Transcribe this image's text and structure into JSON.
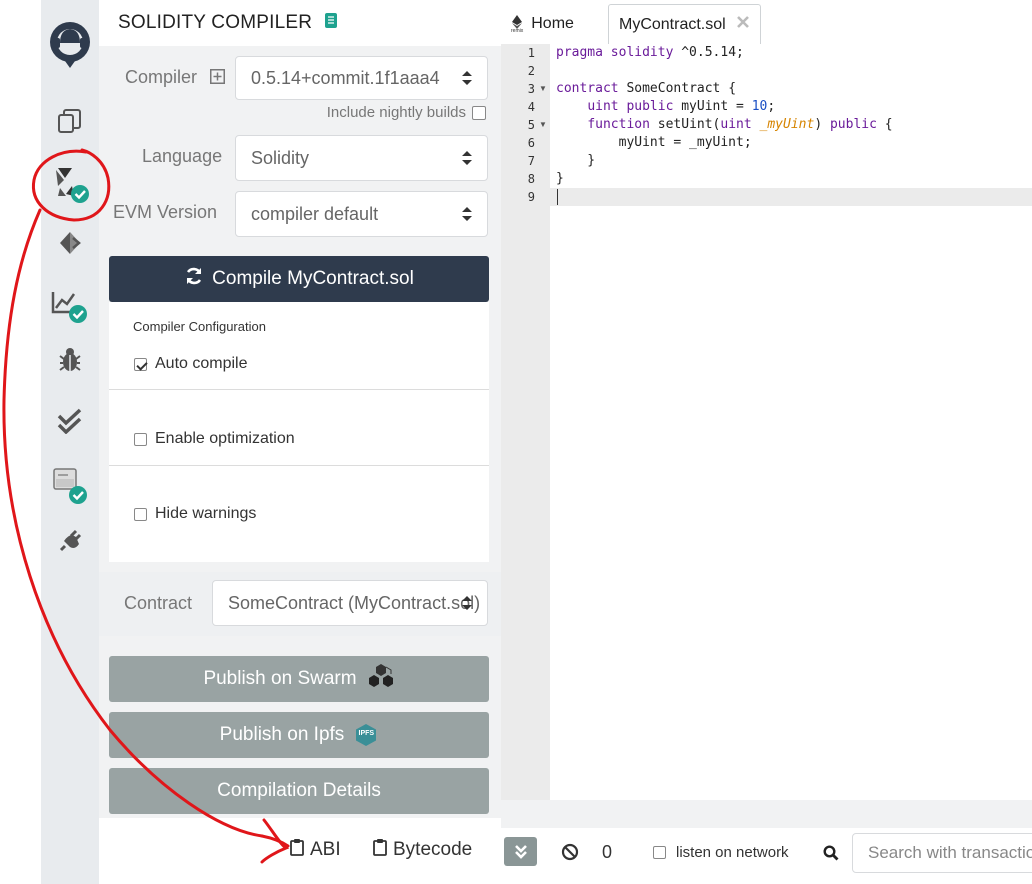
{
  "panel": {
    "title": "SOLIDITY COMPILER",
    "compiler_label": "Compiler",
    "compiler_value": "0.5.14+commit.1f1aaa4",
    "nightly_label": "Include nightly builds",
    "language_label": "Language",
    "language_value": "Solidity",
    "evm_label": "EVM Version",
    "evm_value": "compiler default",
    "compile_button": "Compile MyContract.sol",
    "config_label": "Compiler Configuration",
    "auto_compile": "Auto compile",
    "enable_optimization": "Enable optimization",
    "hide_warnings": "Hide warnings",
    "contract_label": "Contract",
    "contract_value": "SomeContract (MyContract.sol)",
    "publish_swarm": "Publish on Swarm",
    "publish_ipfs": "Publish on Ipfs",
    "ipfs_badge": "IPFS",
    "compilation_details": "Compilation Details",
    "abi_link": "ABI",
    "bytecode_link": "Bytecode"
  },
  "tabs": {
    "home": "Home",
    "home_logo_text": "remix",
    "file": "MyContract.sol"
  },
  "editor": {
    "line_numbers": [
      "1",
      "2",
      "3",
      "4",
      "5",
      "6",
      "7",
      "8",
      "9"
    ],
    "lines": {
      "l1_kw": "pragma solidity",
      "l1_rest": " ^0.5.14;",
      "l3_kw": "contract",
      "l3_rest": " SomeContract {",
      "l4_indent": "    ",
      "l4_kw": "uint public",
      "l4_mid": " myUint = ",
      "l4_num": "10",
      "l4_end": ";",
      "l5_indent": "    ",
      "l5_kw": "function",
      "l5_fn": " setUint(",
      "l5_type": "uint",
      "l5_sp": " ",
      "l5_param": "_myUint",
      "l5_close": ") ",
      "l5_kw2": "public",
      "l5_brace": " {",
      "l6": "        myUint = _myUint;",
      "l7": "    }",
      "l8": "}"
    }
  },
  "terminal": {
    "count": "0",
    "listen_label": "listen on network",
    "search_placeholder": "Search with transactions"
  },
  "colors": {
    "accent_green": "#1ea28f",
    "compile_button": "#2f3b4d",
    "gray_button": "#99a3a3",
    "annotation_red": "#e0161a"
  }
}
